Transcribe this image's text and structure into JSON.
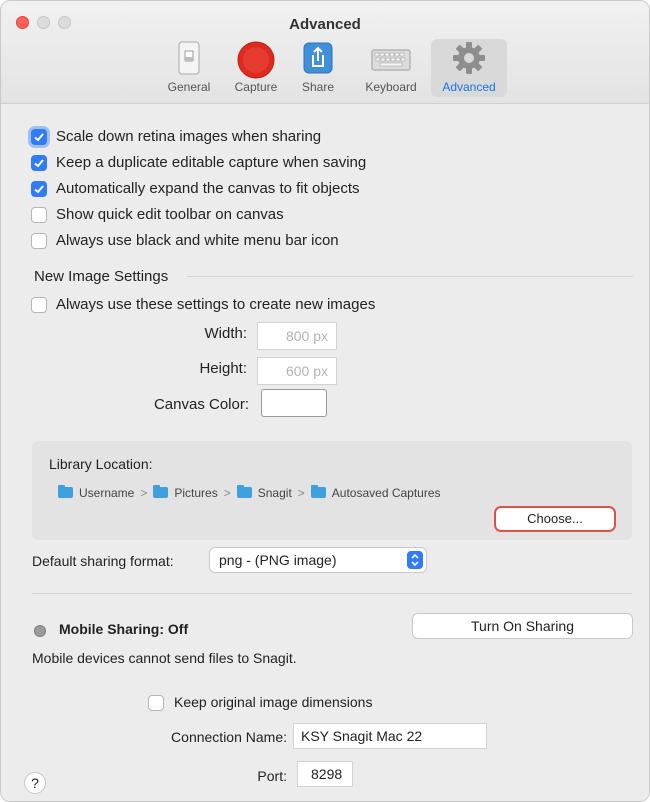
{
  "window": {
    "title": "Advanced"
  },
  "toolbar": {
    "items": [
      {
        "label": "General",
        "icon": "switch-icon"
      },
      {
        "label": "Capture",
        "icon": "record-icon"
      },
      {
        "label": "Share",
        "icon": "share-icon"
      },
      {
        "label": "Keyboard",
        "icon": "keyboard-icon"
      },
      {
        "label": "Advanced",
        "icon": "gear-icon",
        "active": true
      }
    ]
  },
  "options": [
    {
      "label": "Scale down retina images when sharing",
      "checked": true
    },
    {
      "label": "Keep a duplicate editable capture when saving",
      "checked": true
    },
    {
      "label": "Automatically expand the canvas to fit objects",
      "checked": true
    },
    {
      "label": "Show quick edit toolbar on canvas",
      "checked": false
    },
    {
      "label": "Always use black and white menu bar icon",
      "checked": false
    }
  ],
  "new_image": {
    "heading": "New Image Settings",
    "always_use_label": "Always use these settings to create new images",
    "always_use_checked": false,
    "width_label": "Width:",
    "width_value": "800 px",
    "height_label": "Height:",
    "height_value": "600 px",
    "canvas_color_label": "Canvas Color:",
    "canvas_color": "#ffffff"
  },
  "library": {
    "label": "Library Location:",
    "path": [
      "Username",
      "Pictures",
      "Snagit",
      "Autosaved Captures"
    ],
    "separator": ">",
    "choose_label": "Choose..."
  },
  "sharing_format": {
    "label": "Default sharing format:",
    "value": "png - (PNG image)"
  },
  "mobile": {
    "status_label": "Mobile Sharing: Off",
    "turn_on_label": "Turn On Sharing",
    "description": "Mobile devices cannot send files to Snagit.",
    "keep_dims_label": "Keep original image dimensions",
    "keep_dims_checked": false,
    "connection_label": "Connection Name:",
    "connection_value": "KSY Snagit Mac 22",
    "port_label": "Port:",
    "port_value": "8298"
  },
  "help_label": "?",
  "colors": {
    "accent": "#2f7cf6",
    "highlight_ring": "#e0504a",
    "close": "#ff5f57",
    "record": "#e02a1f",
    "share": "#3f8fd9"
  }
}
